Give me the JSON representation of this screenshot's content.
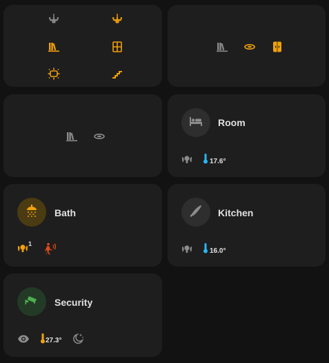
{
  "colors": {
    "accent": "#f2a10b",
    "inactive": "#8c8c8c",
    "temp_blue": "#29b6f6",
    "alarm_red": "#e64a19",
    "security_green": "#4caf50"
  },
  "cards": {
    "room": {
      "title": "Room",
      "temperature": "17.6°",
      "icon": "bed-icon"
    },
    "bath": {
      "title": "Bath",
      "motion_count": "1",
      "icon": "shower-icon"
    },
    "kitchen": {
      "title": "Kitchen",
      "temperature": "16.0°",
      "icon": "knife-icon"
    },
    "security": {
      "title": "Security",
      "temperature": "27.3°",
      "icon": "cctv-icon"
    }
  }
}
